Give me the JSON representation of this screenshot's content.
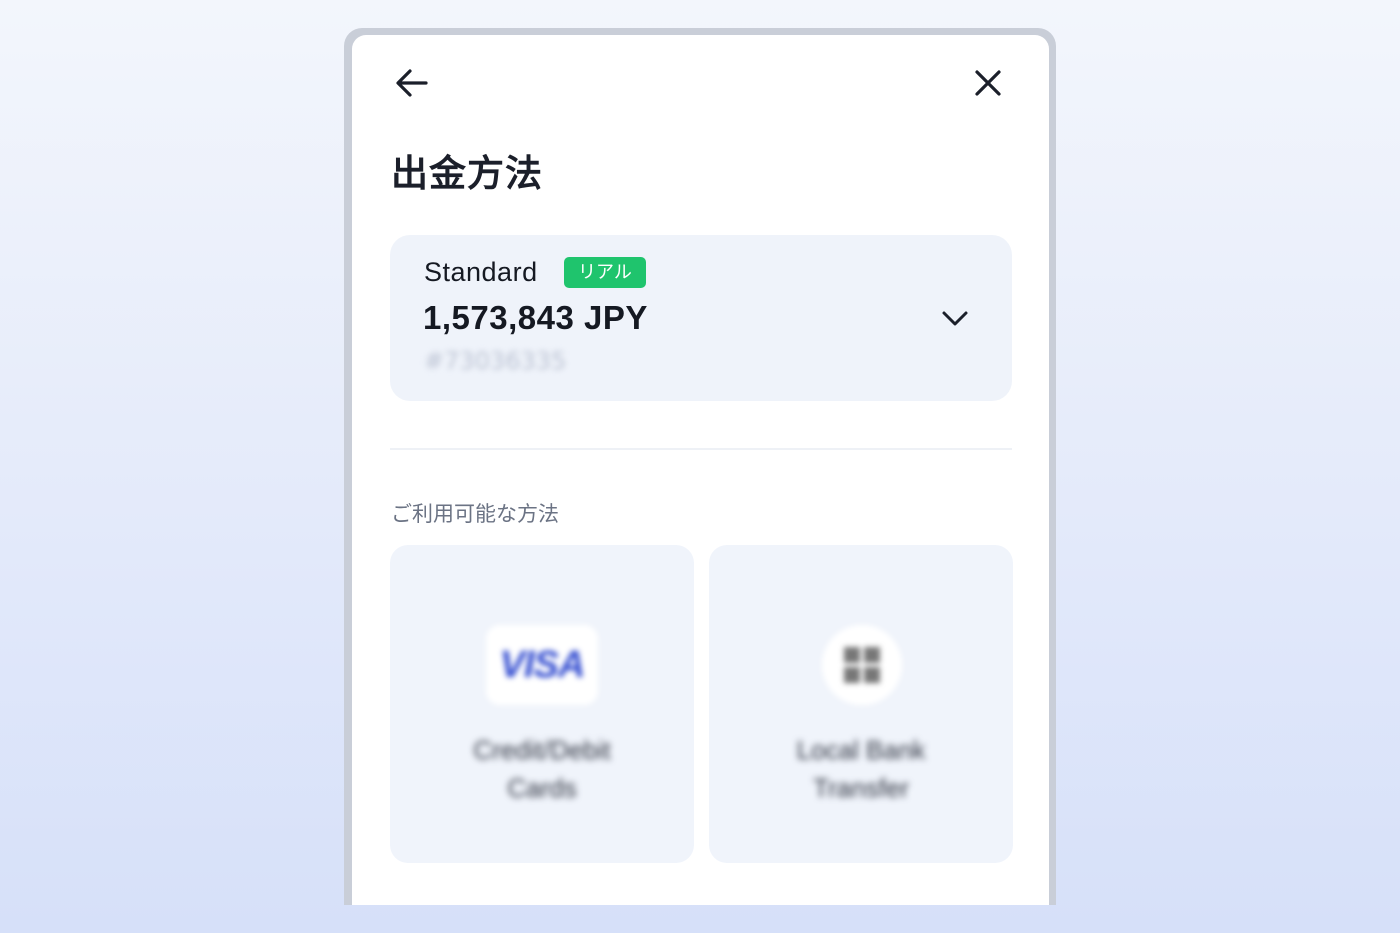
{
  "header": {
    "back_icon": "arrow-left-icon",
    "close_icon": "close-icon",
    "title": "出金方法"
  },
  "account": {
    "type": "Standard",
    "badge": "リアル",
    "balance": "1,573,843 JPY",
    "number": "#73036335",
    "dropdown_icon": "chevron-down-icon",
    "badge_color": "#1fc46d"
  },
  "methods": {
    "section_label": "ご利用可能な方法",
    "items": [
      {
        "logo": "VISA",
        "icon": "visa-logo-icon",
        "label": "Credit/Debit\nCards"
      },
      {
        "icon": "bank-icon",
        "label": "Local Bank\nTransfer"
      }
    ]
  }
}
